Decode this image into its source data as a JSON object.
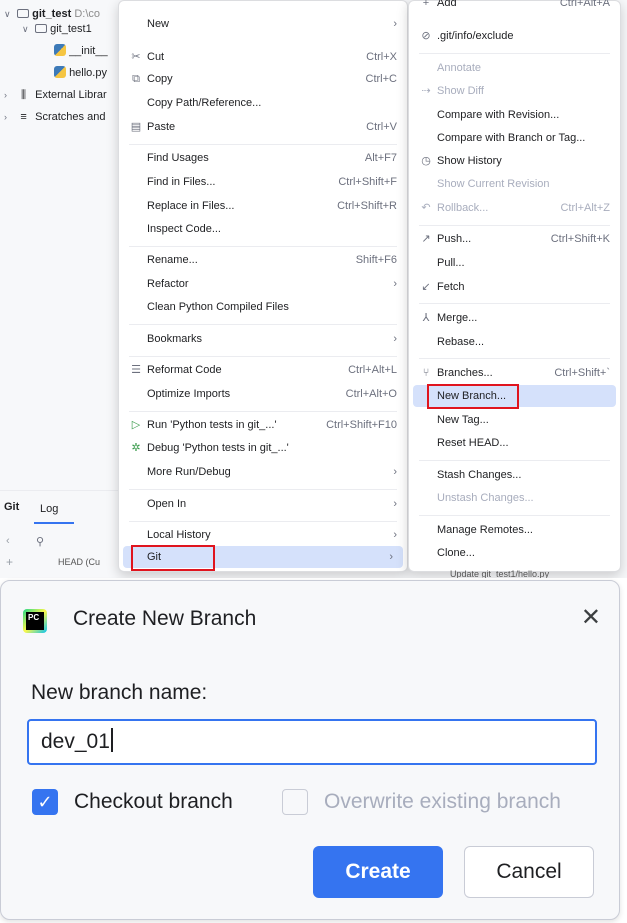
{
  "project_tree": {
    "root_name": "git_test",
    "root_path": "D:\\co",
    "folder": "git_test1",
    "file_init": "__init__",
    "file_hello": "hello.py",
    "external": "External Librar",
    "scratches": "Scratches and"
  },
  "git_panel": {
    "title": "Git",
    "log_tab": "Log",
    "head_text": "HEAD (Cu"
  },
  "main_menu": {
    "items": [
      {
        "label": "New",
        "shortcut": "",
        "submenu": true
      },
      {
        "label": "Cut",
        "shortcut": "Ctrl+X",
        "icon": "scissors-icon"
      },
      {
        "label": "Copy",
        "shortcut": "Ctrl+C",
        "icon": "copy-icon"
      },
      {
        "label": "Copy Path/Reference...",
        "shortcut": ""
      },
      {
        "label": "Paste",
        "shortcut": "Ctrl+V",
        "icon": "paste-icon"
      },
      {
        "label": "Find Usages",
        "shortcut": "Alt+F7"
      },
      {
        "label": "Find in Files...",
        "shortcut": "Ctrl+Shift+F"
      },
      {
        "label": "Replace in Files...",
        "shortcut": "Ctrl+Shift+R"
      },
      {
        "label": "Inspect Code...",
        "shortcut": ""
      },
      {
        "label": "Rename...",
        "shortcut": "Shift+F6"
      },
      {
        "label": "Refactor",
        "shortcut": "",
        "submenu": true
      },
      {
        "label": "Clean Python Compiled Files",
        "shortcut": ""
      },
      {
        "label": "Bookmarks",
        "shortcut": "",
        "submenu": true
      },
      {
        "label": "Reformat Code",
        "shortcut": "Ctrl+Alt+L",
        "icon": "reformat-icon"
      },
      {
        "label": "Optimize Imports",
        "shortcut": "Ctrl+Alt+O"
      },
      {
        "label": "Run 'Python tests in git_...'",
        "shortcut": "Ctrl+Shift+F10",
        "icon": "run-icon"
      },
      {
        "label": "Debug 'Python tests in git_...'",
        "shortcut": "",
        "icon": "debug-icon"
      },
      {
        "label": "More Run/Debug",
        "shortcut": "",
        "submenu": true
      },
      {
        "label": "Open In",
        "shortcut": "",
        "submenu": true
      },
      {
        "label": "Local History",
        "shortcut": "",
        "submenu": true
      },
      {
        "label": "Git",
        "shortcut": "",
        "submenu": true
      }
    ]
  },
  "git_menu": {
    "items": [
      {
        "label": "Add",
        "shortcut": "Ctrl+Alt+A"
      },
      {
        "label": ".git/info/exclude",
        "shortcut": "",
        "icon": "ignore-icon"
      },
      {
        "label": "Annotate",
        "shortcut": "",
        "disabled": true
      },
      {
        "label": "Show Diff",
        "shortcut": "",
        "disabled": true,
        "icon": "diff-icon"
      },
      {
        "label": "Compare with Revision...",
        "shortcut": ""
      },
      {
        "label": "Compare with Branch or Tag...",
        "shortcut": ""
      },
      {
        "label": "Show History",
        "shortcut": "",
        "icon": "history-icon"
      },
      {
        "label": "Show Current Revision",
        "shortcut": "",
        "disabled": true
      },
      {
        "label": "Rollback...",
        "shortcut": "Ctrl+Alt+Z",
        "disabled": true,
        "icon": "rollback-icon"
      },
      {
        "label": "Push...",
        "shortcut": "Ctrl+Shift+K",
        "icon": "push-icon"
      },
      {
        "label": "Pull...",
        "shortcut": ""
      },
      {
        "label": "Fetch",
        "shortcut": "",
        "icon": "fetch-icon"
      },
      {
        "label": "Merge...",
        "shortcut": "",
        "icon": "merge-icon"
      },
      {
        "label": "Rebase...",
        "shortcut": ""
      },
      {
        "label": "Branches...",
        "shortcut": "Ctrl+Shift+`",
        "icon": "branch-icon"
      },
      {
        "label": "New Branch...",
        "shortcut": ""
      },
      {
        "label": "New Tag...",
        "shortcut": ""
      },
      {
        "label": "Reset HEAD...",
        "shortcut": ""
      },
      {
        "label": "Stash Changes...",
        "shortcut": ""
      },
      {
        "label": "Unstash Changes...",
        "shortcut": "",
        "disabled": true
      },
      {
        "label": "Manage Remotes...",
        "shortcut": ""
      },
      {
        "label": "Clone...",
        "shortcut": ""
      }
    ],
    "under_text": "Update git_test1/hello.py"
  },
  "dialog": {
    "title": "Create New Branch",
    "logo_text": "PC",
    "name_label": "New branch name:",
    "name_value": "dev_01",
    "checkout_label": "Checkout branch",
    "checkout_checked": true,
    "overwrite_label": "Overwrite existing branch",
    "overwrite_checked": false,
    "create_label": "Create",
    "cancel_label": "Cancel"
  },
  "colors": {
    "accent": "#3574f0",
    "highlight": "#d5e1fb",
    "annotation_red": "#e0141e"
  }
}
